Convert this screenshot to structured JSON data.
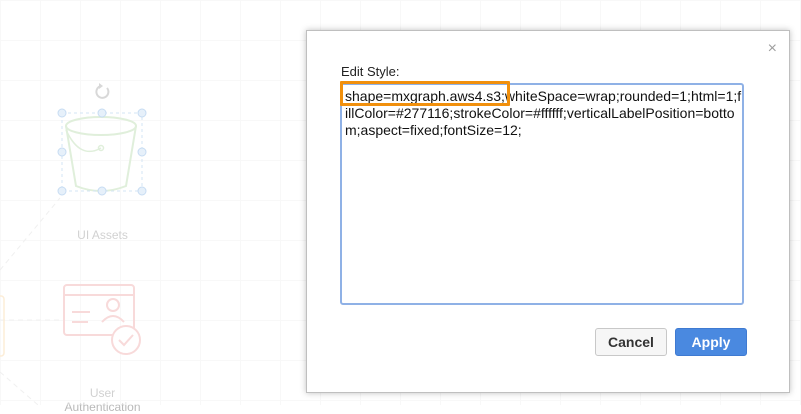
{
  "canvas": {
    "shapes": [
      {
        "label": "UI Assets",
        "icon": "s3-bucket-icon"
      },
      {
        "label": "User Authentication",
        "icon": "user-authentication-icon"
      }
    ]
  },
  "dialog": {
    "title": "Edit Style:",
    "close_glyph": "×",
    "style_value": "shape=mxgraph.aws4.s3;whiteSpace=wrap;rounded=1;html=1;fillColor=#277116;strokeColor=#ffffff;verticalLabelPosition=bottom;aspect=fixed;fontSize=12;",
    "cancel_label": "Cancel",
    "apply_label": "Apply"
  },
  "colors": {
    "highlight": "#f1900d",
    "accent": "#4a89e0",
    "bucket_stroke": "#cfe6c8",
    "auth_icon": "#f5c6c6"
  }
}
